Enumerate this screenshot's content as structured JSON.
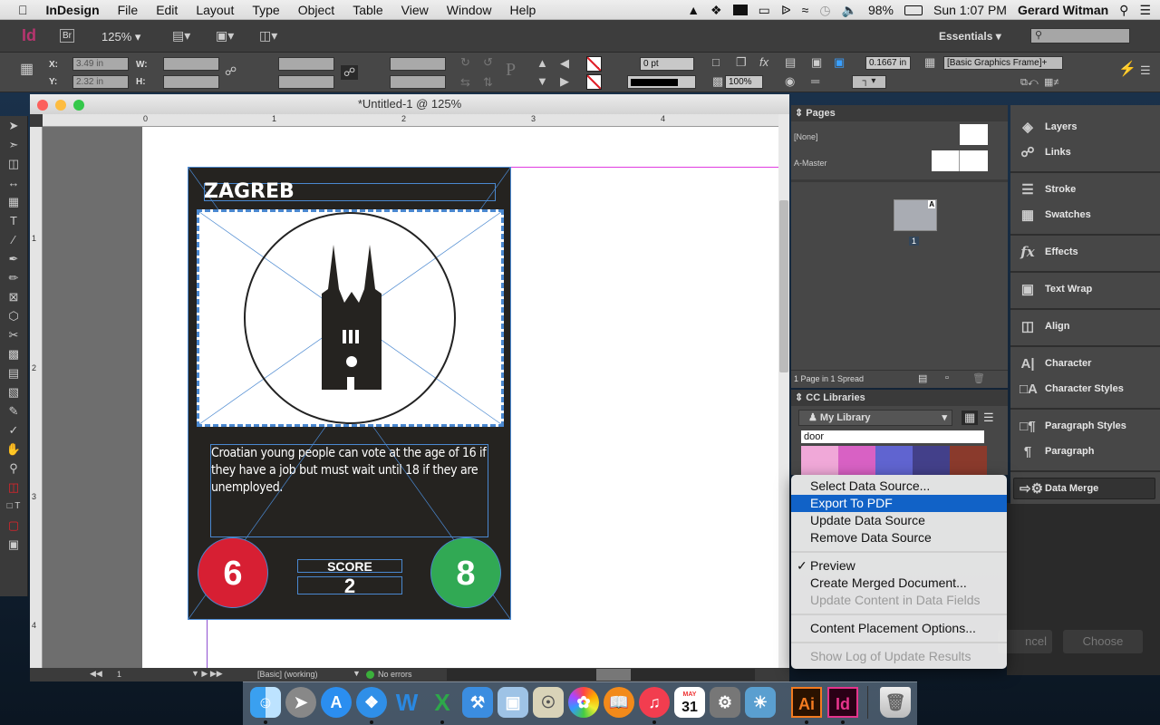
{
  "menubar": {
    "app": "InDesign",
    "items": [
      "File",
      "Edit",
      "Layout",
      "Type",
      "Object",
      "Table",
      "View",
      "Window",
      "Help"
    ],
    "battery": "98%",
    "clock": "Sun 1:07 PM",
    "user": "Gerard Witman"
  },
  "appbar": {
    "logo": "Id",
    "bridge": "Br",
    "zoom": "125%",
    "workspace": "Essentials",
    "search_placeholder": ""
  },
  "control": {
    "x_label": "X:",
    "x": "3.49 in",
    "y_label": "Y:",
    "y": "2.32 in",
    "w_label": "W:",
    "h_label": "H:",
    "stroke_weight": "0 pt",
    "opacity": "100%",
    "fitting": "0.1667 in",
    "object_style": "[Basic Graphics Frame]+"
  },
  "document": {
    "title": "*Untitled-1 @ 125%",
    "ruler_h": [
      "0",
      "1",
      "2",
      "3",
      "4"
    ],
    "ruler_v": [
      "1",
      "2",
      "3",
      "4"
    ],
    "card": {
      "title": "ZAGREB",
      "body": "Croatian young people can vote at the age of 16 if they have a job but must wait until 18 if they are unemployed.",
      "left_value": "6",
      "score_label": "SCORE",
      "score_value": "2",
      "right_value": "8",
      "colors": {
        "background": "#252320",
        "left": "#d71f33",
        "right": "#31a954"
      }
    }
  },
  "status": {
    "page": "1",
    "preflight_profile": "[Basic] (working)",
    "errors": "No errors"
  },
  "pages_panel": {
    "title": "Pages",
    "masters": [
      "[None]",
      "A-Master"
    ],
    "page_number": "1",
    "page_badge": "A",
    "footer": "1 Page in 1 Spread"
  },
  "cc_libraries": {
    "title": "CC Libraries",
    "library": "My Library",
    "search": "door",
    "swatches": [
      "#f0a8d8",
      "#d861c4",
      "#6064d0",
      "#43408a",
      "#8a3a2c"
    ]
  },
  "right_panels": [
    "Layers",
    "Links",
    "Stroke",
    "Swatches",
    "Effects",
    "Text Wrap",
    "Align",
    "Character",
    "Character Styles",
    "Paragraph Styles",
    "Paragraph",
    "Data Merge"
  ],
  "dialog_buttons": {
    "cancel": "ncel",
    "choose": "Choose"
  },
  "data_merge_menu": [
    {
      "label": "Select Data Source...",
      "state": "normal"
    },
    {
      "label": "Export To PDF",
      "state": "highlighted"
    },
    {
      "label": "Update Data Source",
      "state": "normal"
    },
    {
      "label": "Remove Data Source",
      "state": "normal"
    },
    {
      "label": "Preview",
      "state": "checked"
    },
    {
      "label": "Create Merged Document...",
      "state": "normal"
    },
    {
      "label": "Update Content in Data Fields",
      "state": "disabled"
    },
    {
      "label": "Content Placement Options...",
      "state": "normal"
    },
    {
      "label": "Show Log of Update Results",
      "state": "disabled"
    }
  ],
  "dock": {
    "apps": [
      "Finder",
      "Launchpad",
      "App Store",
      "Safari",
      "Word",
      "Excel",
      "Xcode",
      "Preview",
      "Image Capture",
      "Photos",
      "iBooks",
      "iTunes",
      "Calendar",
      "System Preferences",
      "iPhoto",
      "Illustrator",
      "InDesign",
      "Trash"
    ],
    "calendar_month": "MAY",
    "calendar_day": "31",
    "illustrator": "Ai",
    "indesign": "Id"
  }
}
